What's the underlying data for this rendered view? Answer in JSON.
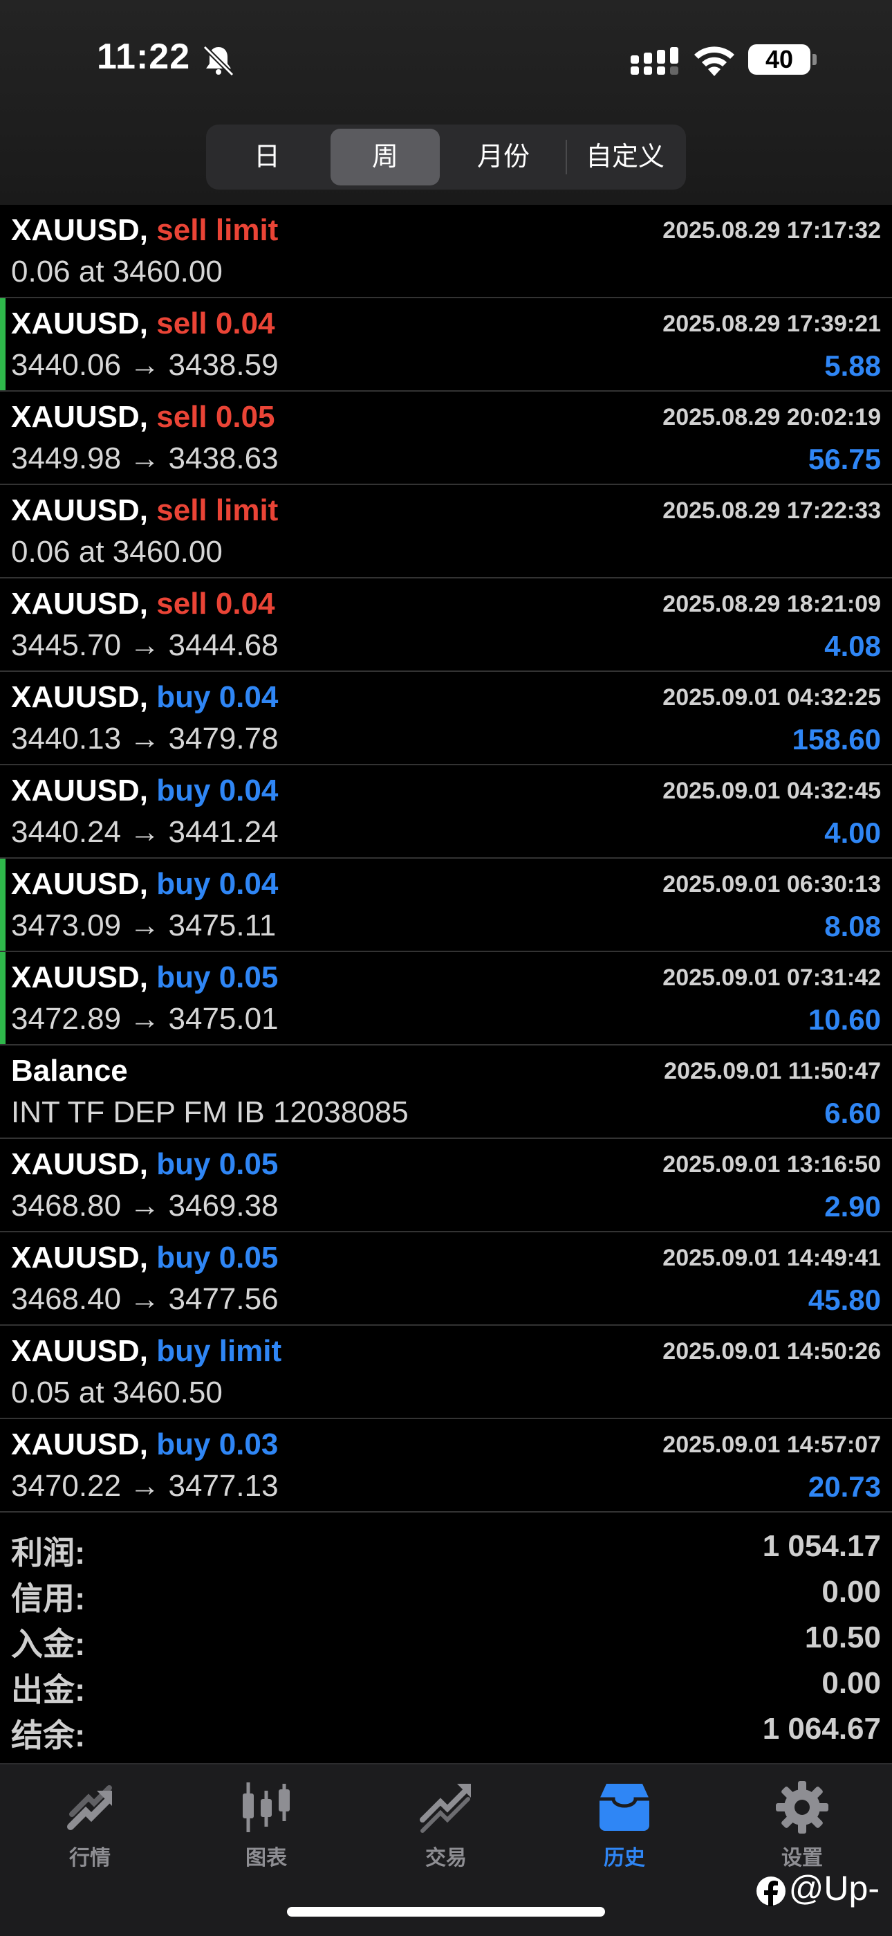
{
  "status_bar": {
    "time": "11:22",
    "battery": "40"
  },
  "segment": {
    "items": [
      {
        "label": "日"
      },
      {
        "label": "周"
      },
      {
        "label": "月份"
      },
      {
        "label": "自定义"
      }
    ],
    "active": "周"
  },
  "colors": {
    "sell": "#ea4436",
    "buy": "#2f86f5",
    "marker": "#2fb84b",
    "accent": "#2f86f5"
  },
  "history": [
    {
      "symbol": "XAUUSD,",
      "side": "sell limit",
      "type": "sell",
      "date": "2025.08.29 17:17:32",
      "detail": "0.06 at 3460.00",
      "profit": "",
      "marked": false
    },
    {
      "symbol": "XAUUSD,",
      "side": "sell 0.04",
      "type": "sell",
      "date": "2025.08.29 17:39:21",
      "detail": "3440.06 → 3438.59",
      "profit": "5.88",
      "marked": true
    },
    {
      "symbol": "XAUUSD,",
      "side": "sell 0.05",
      "type": "sell",
      "date": "2025.08.29 20:02:19",
      "detail": "3449.98 → 3438.63",
      "profit": "56.75",
      "marked": false
    },
    {
      "symbol": "XAUUSD,",
      "side": "sell limit",
      "type": "sell",
      "date": "2025.08.29 17:22:33",
      "detail": "0.06 at 3460.00",
      "profit": "",
      "marked": false
    },
    {
      "symbol": "XAUUSD,",
      "side": "sell 0.04",
      "type": "sell",
      "date": "2025.08.29 18:21:09",
      "detail": "3445.70 → 3444.68",
      "profit": "4.08",
      "marked": false
    },
    {
      "symbol": "XAUUSD,",
      "side": "buy 0.04",
      "type": "buy",
      "date": "2025.09.01 04:32:25",
      "detail": "3440.13 → 3479.78",
      "profit": "158.60",
      "marked": false
    },
    {
      "symbol": "XAUUSD,",
      "side": "buy 0.04",
      "type": "buy",
      "date": "2025.09.01 04:32:45",
      "detail": "3440.24 → 3441.24",
      "profit": "4.00",
      "marked": false
    },
    {
      "symbol": "XAUUSD,",
      "side": "buy 0.04",
      "type": "buy",
      "date": "2025.09.01 06:30:13",
      "detail": "3473.09 → 3475.11",
      "profit": "8.08",
      "marked": true
    },
    {
      "symbol": "XAUUSD,",
      "side": "buy 0.05",
      "type": "buy",
      "date": "2025.09.01 07:31:42",
      "detail": "3472.89 → 3475.01",
      "profit": "10.60",
      "marked": true
    },
    {
      "symbol": "Balance",
      "side": "",
      "type": "balance",
      "date": "2025.09.01 11:50:47",
      "detail": "INT TF DEP FM IB 12038085",
      "profit": "6.60",
      "marked": false
    },
    {
      "symbol": "XAUUSD,",
      "side": "buy 0.05",
      "type": "buy",
      "date": "2025.09.01 13:16:50",
      "detail": "3468.80 → 3469.38",
      "profit": "2.90",
      "marked": false
    },
    {
      "symbol": "XAUUSD,",
      "side": "buy 0.05",
      "type": "buy",
      "date": "2025.09.01 14:49:41",
      "detail": "3468.40 → 3477.56",
      "profit": "45.80",
      "marked": false
    },
    {
      "symbol": "XAUUSD,",
      "side": "buy limit",
      "type": "buy",
      "date": "2025.09.01 14:50:26",
      "detail": "0.05 at 3460.50",
      "profit": "",
      "marked": false
    },
    {
      "symbol": "XAUUSD,",
      "side": "buy 0.03",
      "type": "buy",
      "date": "2025.09.01 14:57:07",
      "detail": "3470.22 → 3477.13",
      "profit": "20.73",
      "marked": false
    }
  ],
  "summary": [
    {
      "label": "利润:",
      "value": "1 054.17"
    },
    {
      "label": "信用:",
      "value": "0.00"
    },
    {
      "label": "入金:",
      "value": "10.50"
    },
    {
      "label": "出金:",
      "value": "0.00"
    },
    {
      "label": "结余:",
      "value": "1 064.67"
    }
  ],
  "tabs": [
    {
      "label": "行情",
      "icon": "quotes-icon"
    },
    {
      "label": "图表",
      "icon": "chart-icon"
    },
    {
      "label": "交易",
      "icon": "trade-icon"
    },
    {
      "label": "历史",
      "icon": "history-icon"
    },
    {
      "label": "设置",
      "icon": "settings-icon"
    }
  ],
  "active_tab": "历史",
  "watermark": "@Up-"
}
